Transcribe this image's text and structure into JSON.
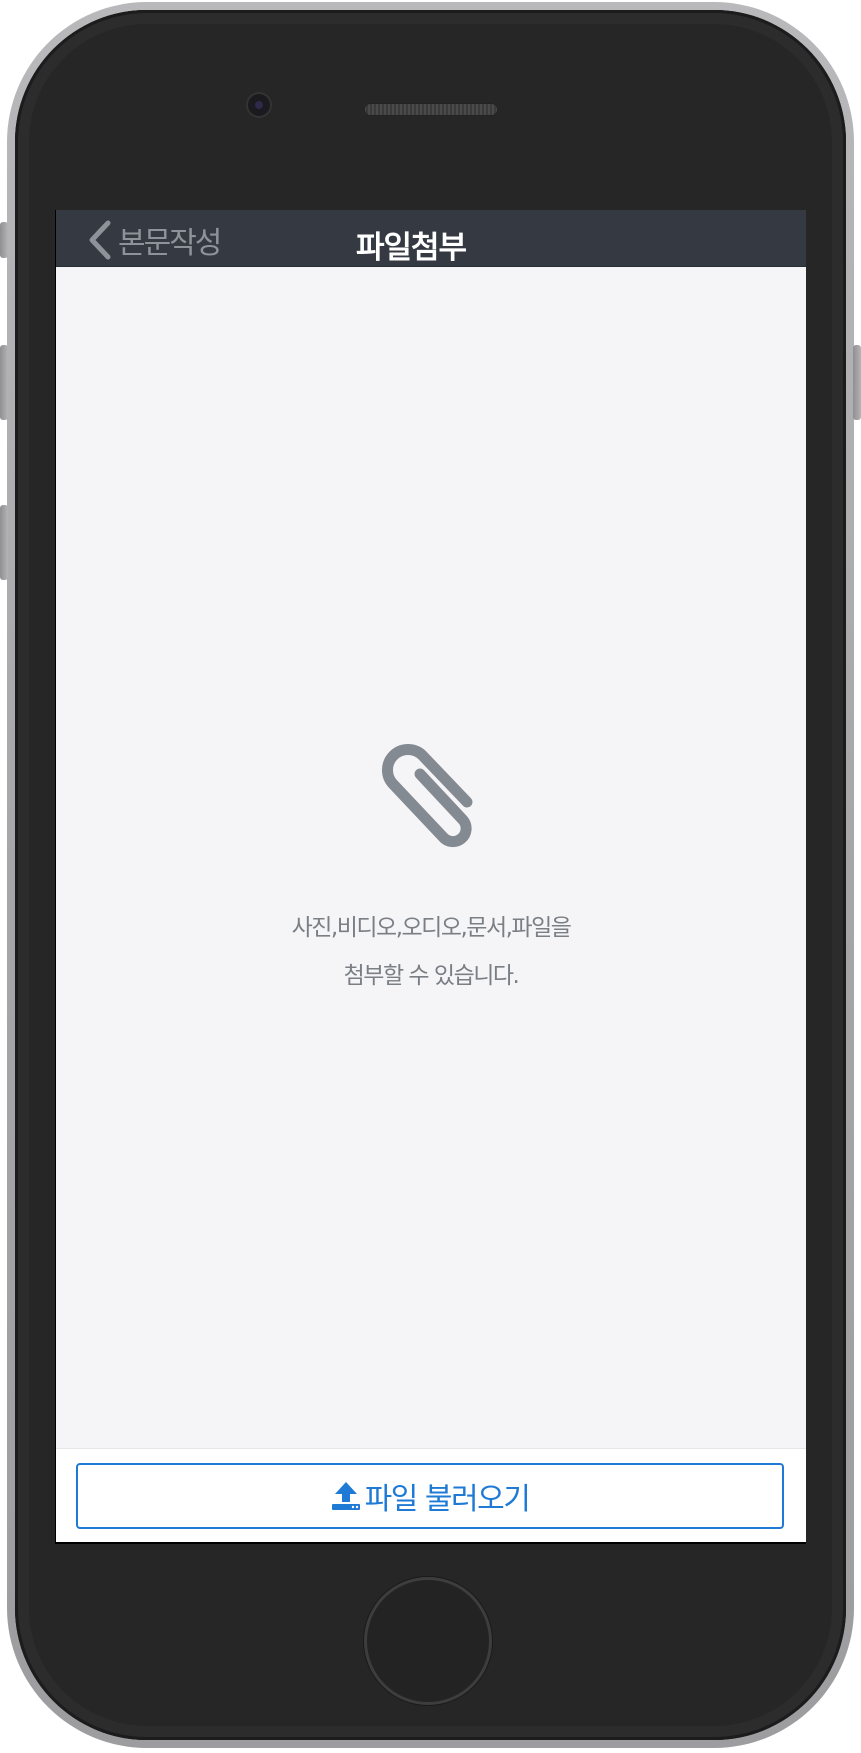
{
  "navbar": {
    "back_label": "본문작성",
    "back_icon": "chevron-left-icon",
    "title": "파일첨부"
  },
  "empty_state": {
    "icon": "paperclip-icon",
    "line1": "사진,비디오,오디오,문서,파일을",
    "line2": "첨부할 수 있습니다."
  },
  "bottom": {
    "upload_icon": "upload-icon",
    "upload_label": "파일 불러오기"
  },
  "colors": {
    "navbar_bg": "#353a42",
    "accent": "#1f7ad6",
    "muted_text": "#7a7e85",
    "icon_gray": "#848a91"
  }
}
